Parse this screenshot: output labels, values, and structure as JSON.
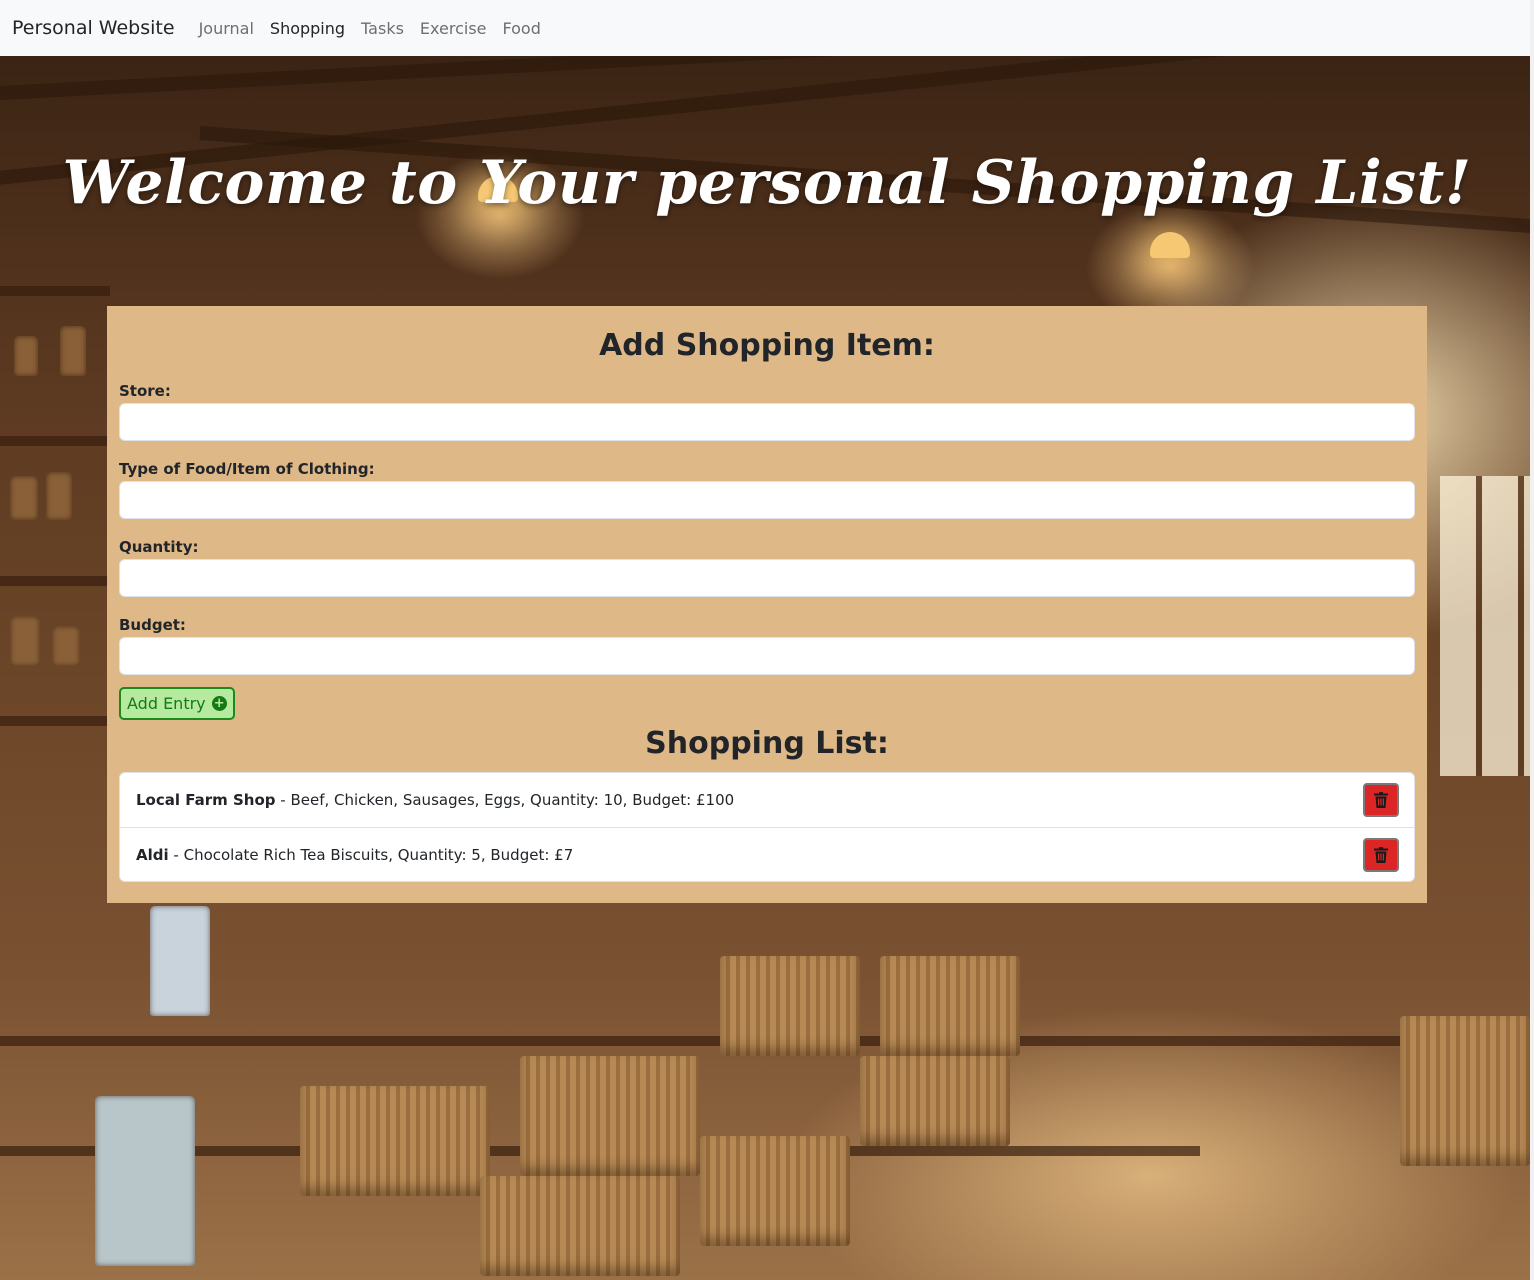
{
  "nav": {
    "brand": "Personal Website",
    "links": [
      {
        "label": "Journal",
        "active": false
      },
      {
        "label": "Shopping",
        "active": true
      },
      {
        "label": "Tasks",
        "active": false
      },
      {
        "label": "Exercise",
        "active": false
      },
      {
        "label": "Food",
        "active": false
      }
    ]
  },
  "hero": {
    "headline": "Welcome to Your personal Shopping List!"
  },
  "form": {
    "title": "Add Shopping Item:",
    "fields": {
      "store": {
        "label": "Store:",
        "value": ""
      },
      "item": {
        "label": "Type of Food/Item of Clothing:",
        "value": ""
      },
      "quantity": {
        "label": "Quantity:",
        "value": ""
      },
      "budget": {
        "label": "Budget:",
        "value": ""
      }
    },
    "submit_label": "Add Entry",
    "submit_icon": "plus-circle-icon"
  },
  "list": {
    "title": "Shopping List:",
    "items": [
      {
        "store": "Local Farm Shop",
        "details": " - Beef, Chicken, Sausages, Eggs, Quantity: 10, Budget: £100"
      },
      {
        "store": "Aldi",
        "details": " - Chocolate Rich Tea Biscuits, Quantity: 5, Budget: £7"
      }
    ],
    "delete_icon": "trash-icon"
  },
  "colors": {
    "navbar_bg": "#f8f9fa",
    "card_bg": "#deb887",
    "add_button_bg": "#b6ea9e",
    "add_button_border": "#1b8a1b",
    "delete_button_bg": "#dc2626"
  }
}
